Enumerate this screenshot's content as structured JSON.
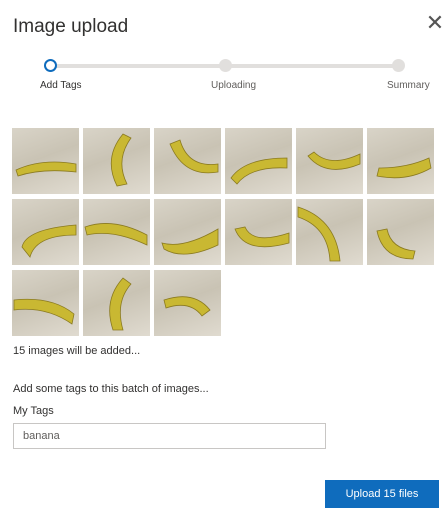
{
  "dialog": {
    "title": "Image upload"
  },
  "close_icon": "close-icon",
  "stepper": {
    "steps": [
      {
        "label": "Add Tags",
        "state": "active"
      },
      {
        "label": "Uploading",
        "state": "pending"
      },
      {
        "label": "Summary",
        "state": "pending"
      }
    ]
  },
  "images": {
    "count_text": "15 images will be added...",
    "thumbnails": [
      {
        "subject": "banana"
      },
      {
        "subject": "banana"
      },
      {
        "subject": "banana"
      },
      {
        "subject": "banana"
      },
      {
        "subject": "banana"
      },
      {
        "subject": "banana"
      },
      {
        "subject": "banana"
      },
      {
        "subject": "banana"
      },
      {
        "subject": "banana"
      },
      {
        "subject": "banana"
      },
      {
        "subject": "banana"
      },
      {
        "subject": "banana"
      },
      {
        "subject": "banana"
      },
      {
        "subject": "banana"
      },
      {
        "subject": "banana"
      }
    ]
  },
  "tags": {
    "hint": "Add some tags to this batch of images...",
    "label": "My Tags",
    "value": "banana"
  },
  "footer": {
    "upload_label": "Upload 15 files"
  },
  "colors": {
    "accent": "#0f6cbd",
    "banana": "#c9b832"
  }
}
